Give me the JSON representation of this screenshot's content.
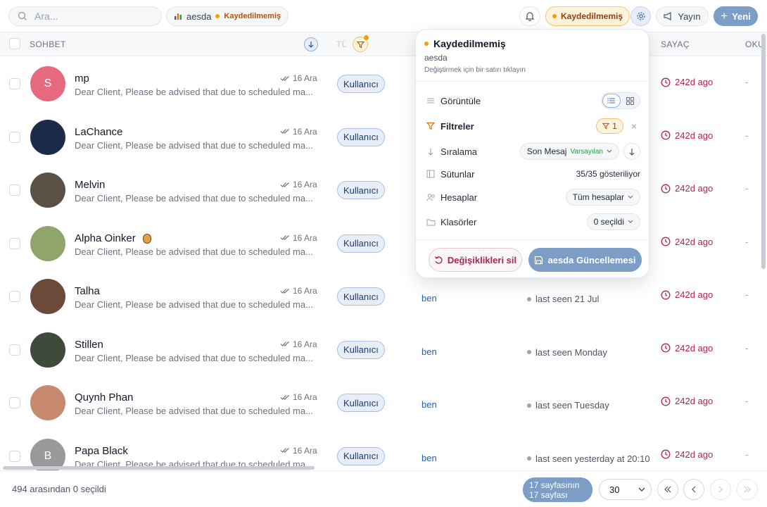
{
  "search": {
    "placeholder": "Ara..."
  },
  "view_chip": {
    "name": "aesda",
    "status": "Kaydedilmemiş"
  },
  "header_actions": {
    "unsaved_label": "Kaydedilmemiş",
    "publish_label": "Yayın",
    "new_label": "Yeni"
  },
  "table": {
    "headers": {
      "chat": "SOHBET",
      "type": "TÜ",
      "counter": "SAYAÇ",
      "read": "OKU"
    },
    "rows": [
      {
        "name": "mp",
        "preview": "Dear Client, Please be advised that due to scheduled ma...",
        "date": "16 Ara",
        "role": "Kullanıcı",
        "assignee": "",
        "seen": "",
        "counter": "242d ago",
        "extra": "-",
        "avatar_initial": "S",
        "avatar_color": "#e56a7e"
      },
      {
        "name": "LaChance",
        "preview": "Dear Client, Please be advised that due to scheduled ma...",
        "date": "16 Ara",
        "role": "Kullanıcı",
        "assignee": "",
        "seen": "",
        "counter": "242d ago",
        "extra": "-",
        "avatar_initial": "",
        "avatar_color": "#1c2a4a"
      },
      {
        "name": "Melvin",
        "preview": "Dear Client, Please be advised that due to scheduled ma...",
        "date": "16 Ara",
        "role": "Kullanıcı",
        "assignee": "",
        "seen": "",
        "counter": "242d ago",
        "extra": "-",
        "avatar_initial": "",
        "avatar_color": "#5b5145"
      },
      {
        "name": "Alpha Oinker",
        "preview": "Dear Client, Please be advised that due to scheduled ma...",
        "date": "16 Ara",
        "role": "Kullanıcı",
        "assignee": "",
        "seen": "",
        "counter": "242d ago",
        "extra": "-",
        "avatar_initial": "",
        "avatar_color": "#8fa56b"
      },
      {
        "name": "Talha",
        "preview": "Dear Client, Please be advised that due to scheduled ma...",
        "date": "16 Ara",
        "role": "Kullanıcı",
        "assignee": "ben",
        "seen": "last seen 21 Jul",
        "counter": "242d ago",
        "extra": "-",
        "avatar_initial": "",
        "avatar_color": "#6b4a3a"
      },
      {
        "name": "Stillen",
        "preview": "Dear Client, Please be advised that due to scheduled ma...",
        "date": "16 Ara",
        "role": "Kullanıcı",
        "assignee": "ben",
        "seen": "last seen Monday",
        "counter": "242d ago",
        "extra": "-",
        "avatar_initial": "",
        "avatar_color": "#3e4a3a"
      },
      {
        "name": "Quynh Phan",
        "preview": "Dear Client, Please be advised that due to scheduled ma...",
        "date": "16 Ara",
        "role": "Kullanıcı",
        "assignee": "ben",
        "seen": "last seen Tuesday",
        "counter": "242d ago",
        "extra": "-",
        "avatar_initial": "",
        "avatar_color": "#c78a6e"
      },
      {
        "name": "Papa Black",
        "preview": "Dear Client, Please be advised that due to scheduled ma...",
        "date": "16 Ara",
        "role": "Kullanıcı",
        "assignee": "ben",
        "seen": "last seen yesterday at 20:10",
        "counter": "242d ago",
        "extra": "-",
        "avatar_initial": "B",
        "avatar_color": "#9a9a9a"
      }
    ]
  },
  "popup": {
    "title": "Kaydedilmemiş",
    "subtitle": "aesda",
    "hint": "Değiştirmek için bir satırı tıklayın",
    "view_label": "Görüntüle",
    "filters_label": "Filtreler",
    "filters_count": "1",
    "filters_clear": "×",
    "sort_label": "Sıralama",
    "sort_value": "Son Mesaj",
    "sort_default": "Varsayılan",
    "columns_label": "Sütunlar",
    "columns_value": "35/35 gösteriliyor",
    "accounts_label": "Hesaplar",
    "accounts_value": "Tüm hesaplar",
    "folders_label": "Klasörler",
    "folders_value": "0 seçildi",
    "discard_label": "Değişiklikleri sil",
    "update_label": "aesda Güncellemesi"
  },
  "footer": {
    "selected_text": "494 arasından 0 seçildi",
    "page_line1": "17 sayfasının",
    "page_line2": "17 sayfası",
    "page_size": "30"
  },
  "colors": {
    "accent": "#7b9dc6",
    "warning": "#f59e0b",
    "danger": "#b42348"
  }
}
